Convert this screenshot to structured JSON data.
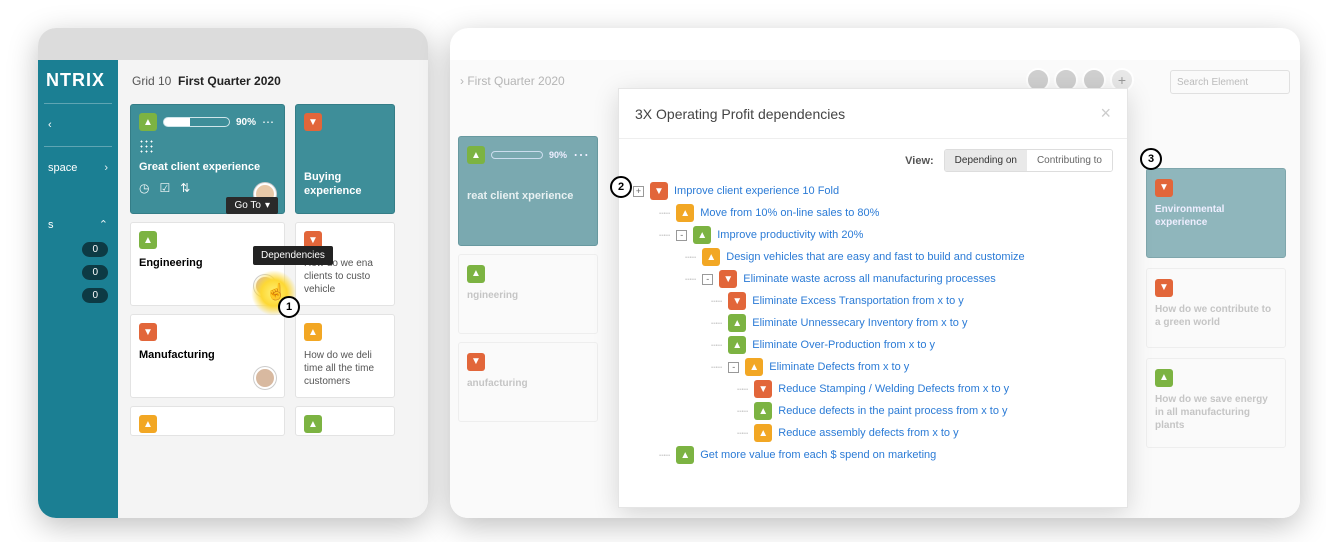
{
  "left": {
    "logo": "NTRIX",
    "crumbs_prefix": "Grid 10",
    "crumbs_title": "First Quarter 2020",
    "sidebar": {
      "space": "space",
      "s": "s",
      "badge": "0"
    },
    "tooltip": "Dependencies",
    "goto": "Go To",
    "step1": "1",
    "teal_card": {
      "pct": "90%",
      "title": "Great client experience"
    },
    "col1": {
      "c1": "Engineering",
      "c2": "Manufacturing"
    },
    "col2": {
      "c1": "Buying experience",
      "c2": "How do we ena clients to custo vehicle",
      "c3": "How do we deli time all the time customers"
    }
  },
  "right": {
    "crumbs": "First Quarter 2020",
    "search_ph": "Search Element",
    "modal_title": "3X Operating Profit dependencies",
    "view_label": "View:",
    "seg": {
      "a": "Depending on",
      "b": "Contributing to"
    },
    "step2": "2",
    "step3": "3",
    "bg": {
      "teal_title": "reat client xperience",
      "teal_pct": "90%",
      "c1": "ngineering",
      "c2": "anufacturing",
      "r1": "Environmental experience",
      "r2": "How do we contribute to a green world",
      "r3": "How do we save energy in all manufacturing plants"
    },
    "tree": [
      {
        "lvl": 0,
        "exp": "+",
        "chip": "dn",
        "t": "Improve client experience 10 Fold"
      },
      {
        "lvl": 1,
        "exp": "",
        "chip": "yl",
        "t": "Move from 10% on-line sales to 80%"
      },
      {
        "lvl": 1,
        "exp": "-",
        "chip": "up",
        "t": "Improve productivity with 20%"
      },
      {
        "lvl": 2,
        "exp": "",
        "chip": "yl",
        "t": "Design vehicles that are easy and fast to build and customize"
      },
      {
        "lvl": 2,
        "exp": "-",
        "chip": "dn",
        "t": "Eliminate waste across all manufacturing processes"
      },
      {
        "lvl": 3,
        "exp": "",
        "chip": "dn",
        "t": "Eliminate Excess Transportation from x to y"
      },
      {
        "lvl": 3,
        "exp": "",
        "chip": "up",
        "t": "Eliminate Unnessecary Inventory from x to y"
      },
      {
        "lvl": 3,
        "exp": "",
        "chip": "up",
        "t": "Eliminate Over-Production from x to y"
      },
      {
        "lvl": 3,
        "exp": "-",
        "chip": "yl",
        "t": "Eliminate Defects from x to y"
      },
      {
        "lvl": 4,
        "exp": "",
        "chip": "dn",
        "t": "Reduce Stamping / Welding Defects from x to y"
      },
      {
        "lvl": 4,
        "exp": "",
        "chip": "up",
        "t": "Reduce defects in the paint process from x to y"
      },
      {
        "lvl": 4,
        "exp": "",
        "chip": "yl",
        "t": "Reduce assembly defects from x to y"
      },
      {
        "lvl": 1,
        "exp": "",
        "chip": "up",
        "t": "Get more value from each $ spend on marketing"
      }
    ]
  }
}
